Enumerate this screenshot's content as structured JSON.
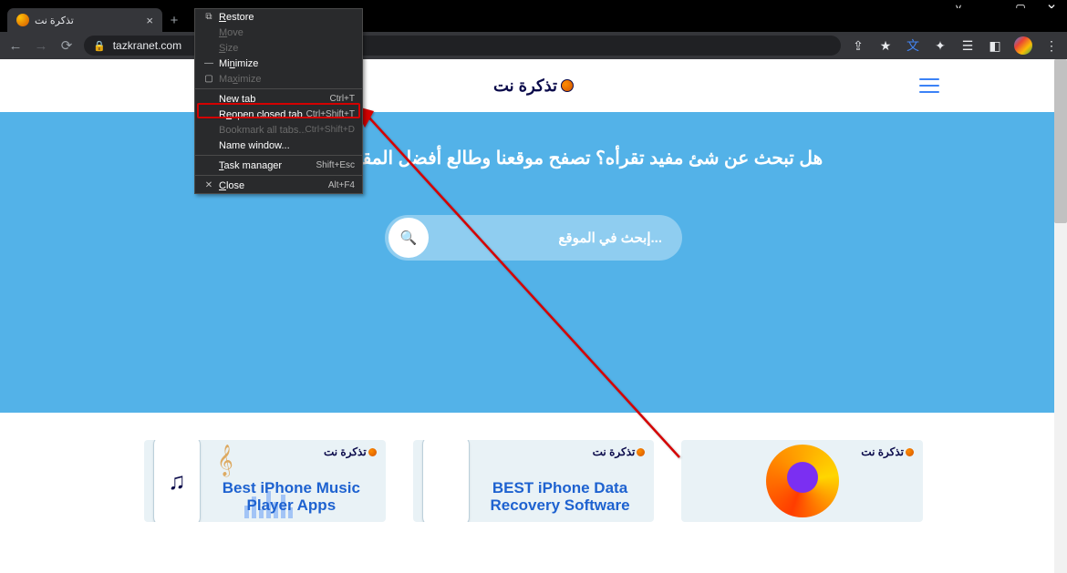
{
  "window": {
    "tab_title": "تذكرة نت",
    "url": "tazkranet.com"
  },
  "context_menu": [
    {
      "icon": "⧉",
      "label": "Restore",
      "underline_index": 0,
      "shortcut": "",
      "enabled": true
    },
    {
      "icon": "",
      "label": "Move",
      "underline_index": 0,
      "shortcut": "",
      "enabled": false
    },
    {
      "icon": "",
      "label": "Size",
      "underline_index": 0,
      "shortcut": "",
      "enabled": false
    },
    {
      "icon": "—",
      "label": "Minimize",
      "underline_index": 2,
      "shortcut": "",
      "enabled": true
    },
    {
      "icon": "▢",
      "label": "Maximize",
      "underline_index": 2,
      "shortcut": "",
      "enabled": false
    },
    {
      "sep": true
    },
    {
      "icon": "",
      "label": "New tab",
      "underline_index": -1,
      "shortcut": "Ctrl+T",
      "enabled": true
    },
    {
      "icon": "",
      "label": "Reopen closed tab",
      "underline_index": 1,
      "shortcut": "Ctrl+Shift+T",
      "enabled": true,
      "highlight": true
    },
    {
      "icon": "",
      "label": "Bookmark all tabs...",
      "underline_index": -1,
      "shortcut": "Ctrl+Shift+D",
      "enabled": false
    },
    {
      "icon": "",
      "label": "Name window...",
      "underline_index": -1,
      "shortcut": "",
      "enabled": true
    },
    {
      "sep": true
    },
    {
      "icon": "",
      "label": "Task manager",
      "underline_index": 0,
      "shortcut": "Shift+Esc",
      "enabled": true
    },
    {
      "sep": true
    },
    {
      "icon": "✕",
      "label": "Close",
      "underline_index": 0,
      "shortcut": "Alt+F4",
      "enabled": true
    }
  ],
  "site": {
    "logo_text": "تذكرة نت",
    "hero_text": "هل تبحث عن شئ مفيد تقرأه؟ تصفح موقعنا وطالع أفضل المقالات على الويب",
    "search_placeholder": "...إبحث في الموقع"
  },
  "cards": [
    {
      "title": "Best iPhone Music Player Apps"
    },
    {
      "title": "BEST iPhone Data Recovery Software"
    },
    {
      "title": ""
    }
  ]
}
